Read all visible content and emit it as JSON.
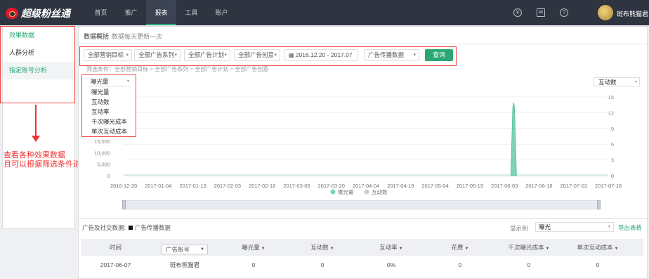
{
  "app": {
    "title": "超级粉丝通"
  },
  "nav": {
    "items": [
      "首页",
      "推广",
      "报表",
      "工具",
      "账户"
    ],
    "active_index": 2
  },
  "user": {
    "name": "斑布熊猫君"
  },
  "sidebar": {
    "items": [
      "效果数据",
      "人群分析",
      "指定账号分析"
    ]
  },
  "annotation": {
    "line1": "查看各种效果数据",
    "line2": "且可以根据筛选条件进行数据查看"
  },
  "overview": {
    "title": "数据概括",
    "subtitle": "数据每天更新一次"
  },
  "filters": {
    "target": "全部营销目标",
    "series": "全部广告系列",
    "plan": "全部广告计划",
    "creative": "全部广告创意",
    "date_range": "2016.12.20 - 2017.07",
    "data_type": "广告传播数据",
    "query_label": "查询"
  },
  "breadcrumb": "筛选条件：全部营销目标  >  全部广告系列  >  全部广告计划  >  全部广告创意",
  "metric_select": {
    "value": "曝光量",
    "options": [
      "曝光量",
      "互动数",
      "互动率",
      "千次曝光成本",
      "单次互动成本"
    ]
  },
  "right_select": {
    "value": "互动数"
  },
  "colors": {
    "accent": "#2aa773",
    "topbar": "#2e3440",
    "annotation": "#e33333"
  },
  "chart_data": {
    "type": "area",
    "x_ticks": [
      "2016-12-20",
      "2017-01-04",
      "2017-01-19",
      "2017-02-03",
      "2017-02-18",
      "2017-03-05",
      "2017-03-20",
      "2017-04-04",
      "2017-04-19",
      "2017-05-04",
      "2017-05-19",
      "2017-06-03",
      "2017-06-18",
      "2017-07-03",
      "2017-07-18"
    ],
    "y_left_ticks": [
      "15,000",
      "10,000",
      "5,000",
      "0"
    ],
    "y_right_ticks": [
      "15",
      "12",
      "9",
      "6",
      "3",
      "0"
    ],
    "series": [
      {
        "name": "曝光量",
        "color": "#7ed3b2",
        "peak_date": "2017-06-07",
        "peak_value": 22000
      },
      {
        "name": "互动数",
        "color": "#cccccc",
        "peak_value": 0
      }
    ],
    "legend_position": "bottom"
  },
  "table": {
    "label": "广告及社交数据:",
    "legend": "广告传播数据",
    "cols_label": "显示列",
    "cols_value": "曝光",
    "export": "导出表格",
    "headers": [
      "时间",
      "广告账号",
      "曝光量",
      "互动数",
      "互动率",
      "花费",
      "千次曝光成本",
      "单次互动成本"
    ],
    "rows": [
      [
        "2017-06-07",
        "斑布熊猫君",
        "0",
        "0",
        "0%",
        "0",
        "0",
        "0"
      ]
    ]
  }
}
